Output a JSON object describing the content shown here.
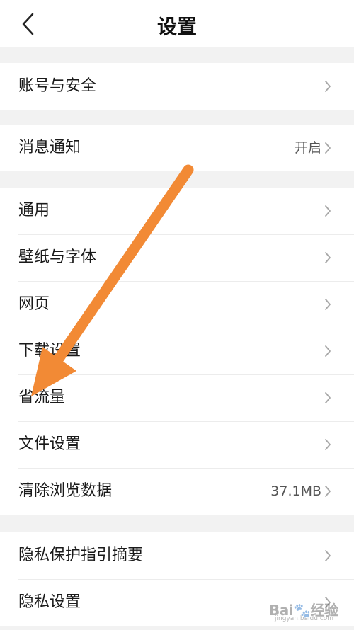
{
  "header": {
    "title": "设置"
  },
  "groups": [
    {
      "items": [
        {
          "label": "账号与安全"
        }
      ]
    },
    {
      "items": [
        {
          "label": "消息通知",
          "value": "开启"
        }
      ]
    },
    {
      "items": [
        {
          "label": "通用"
        },
        {
          "label": "壁纸与字体"
        },
        {
          "label": "网页"
        },
        {
          "label": "下载设置"
        },
        {
          "label": "省流量"
        },
        {
          "label": "文件设置"
        },
        {
          "label": "清除浏览数据",
          "value": "37.1MB"
        }
      ]
    },
    {
      "items": [
        {
          "label": "隐私保护指引摘要"
        },
        {
          "label": "隐私设置"
        }
      ]
    }
  ],
  "annotation": {
    "color": "#f28a35",
    "points_to": "省流量"
  },
  "watermark": {
    "brand": "Bai",
    "product": "经验",
    "url": "jingyan.baidu.com"
  },
  "icons": {
    "back": "chevron-left-icon",
    "row_arrow": "chevron-right-icon"
  }
}
